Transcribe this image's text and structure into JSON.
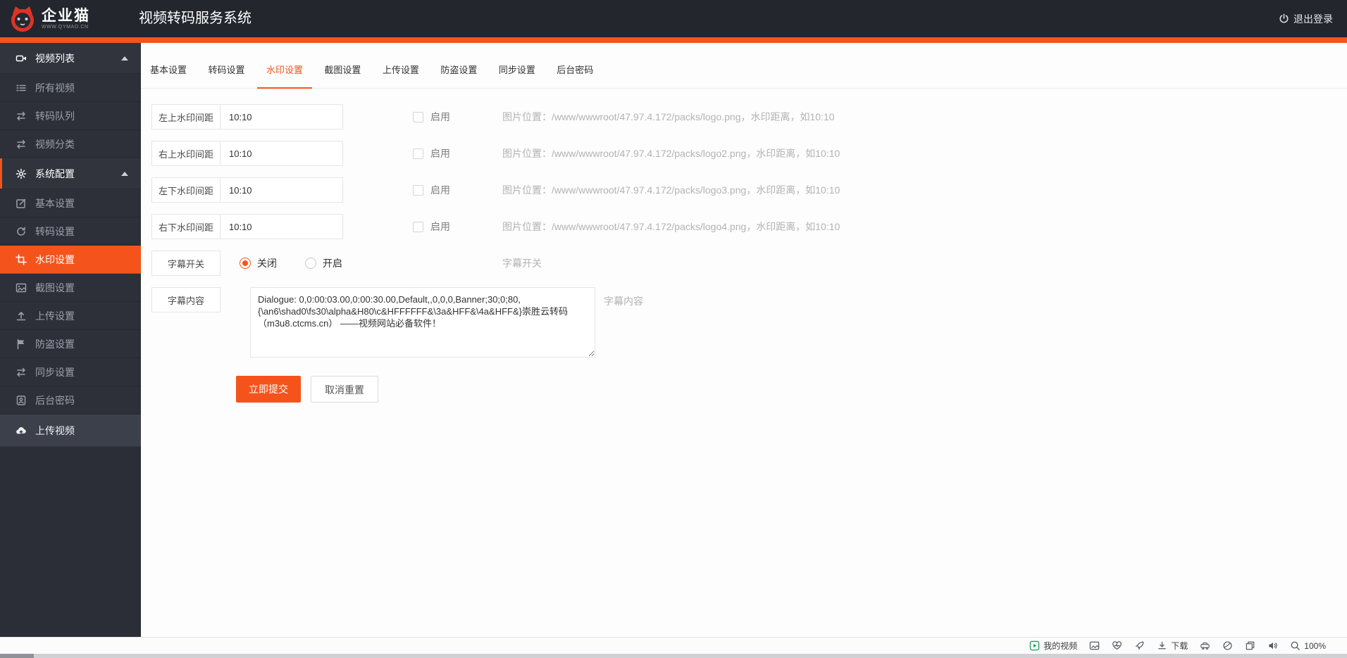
{
  "header": {
    "brand": "企业猫",
    "brand_tagline": "WWW.QYMAO.CN",
    "title": "视频转码服务系统",
    "logout_label": "退出登录"
  },
  "sidebar": {
    "items": [
      {
        "label": "视频列表",
        "icon": "video-camera",
        "type": "section"
      },
      {
        "label": "所有视频",
        "icon": "list",
        "type": "item"
      },
      {
        "label": "转码队列",
        "icon": "exchange",
        "type": "item"
      },
      {
        "label": "视频分类",
        "icon": "exchange",
        "type": "item"
      },
      {
        "label": "系统配置",
        "icon": "gear",
        "type": "section"
      },
      {
        "label": "基本设置",
        "icon": "edit",
        "type": "item"
      },
      {
        "label": "转码设置",
        "icon": "refresh",
        "type": "item"
      },
      {
        "label": "水印设置",
        "icon": "crop",
        "type": "item",
        "active": true
      },
      {
        "label": "截图设置",
        "icon": "image",
        "type": "item"
      },
      {
        "label": "上传设置",
        "icon": "upload",
        "type": "item"
      },
      {
        "label": "防盗设置",
        "icon": "flag",
        "type": "item"
      },
      {
        "label": "同步设置",
        "icon": "exchange",
        "type": "item"
      },
      {
        "label": "后台密码",
        "icon": "id-card",
        "type": "item"
      },
      {
        "label": "上传视频",
        "icon": "cloud-upload",
        "type": "item-light"
      }
    ]
  },
  "tabs": {
    "items": [
      "基本设置",
      "转码设置",
      "水印设置",
      "截图设置",
      "上传设置",
      "防盗设置",
      "同步设置",
      "后台密码"
    ],
    "active": "水印设置"
  },
  "form": {
    "watermark_rows": [
      {
        "label": "左上水印间距",
        "value": "10:10",
        "enable_label": "启用",
        "checked": false,
        "hint": "图片位置：/www/wwwroot/47.97.4.172/packs/logo.png，水印距离，如10:10"
      },
      {
        "label": "右上水印间距",
        "value": "10:10",
        "enable_label": "启用",
        "checked": false,
        "hint": "图片位置：/www/wwwroot/47.97.4.172/packs/logo2.png，水印距离，如10:10"
      },
      {
        "label": "左下水印间距",
        "value": "10:10",
        "enable_label": "启用",
        "checked": false,
        "hint": "图片位置：/www/wwwroot/47.97.4.172/packs/logo3.png，水印距离，如10:10"
      },
      {
        "label": "右下水印间距",
        "value": "10:10",
        "enable_label": "启用",
        "checked": false,
        "hint": "图片位置：/www/wwwroot/47.97.4.172/packs/logo4.png，水印距离，如10:10"
      }
    ],
    "subtitle_switch": {
      "label": "字幕开关",
      "option_off": "关闭",
      "option_on": "开启",
      "selected": "关闭",
      "hint": "字幕开关"
    },
    "subtitle_content": {
      "label": "字幕内容",
      "hint": "字幕内容",
      "value": "Dialogue: 0,0:00:03.00,0:00:30.00,Default,,0,0,0,Banner;30;0;80,\n{\\an6\\shad0\\fs30\\alpha&H80\\c&HFFFFFF&\\3a&HFF&\\4a&HFF&}崇胜云转码\n（m3u8.ctcms.cn） ——视频网站必备软件！"
    },
    "submit_label": "立即提交",
    "reset_label": "取消重置"
  },
  "statusbar": {
    "my_videos_label": "我的视频",
    "download_label": "下载",
    "zoom_level": "100%"
  },
  "colors": {
    "accent": "#f4541c",
    "header_bg": "#23262d",
    "sidebar_bg": "#2b2e37",
    "status_green": "#1ea25a"
  }
}
